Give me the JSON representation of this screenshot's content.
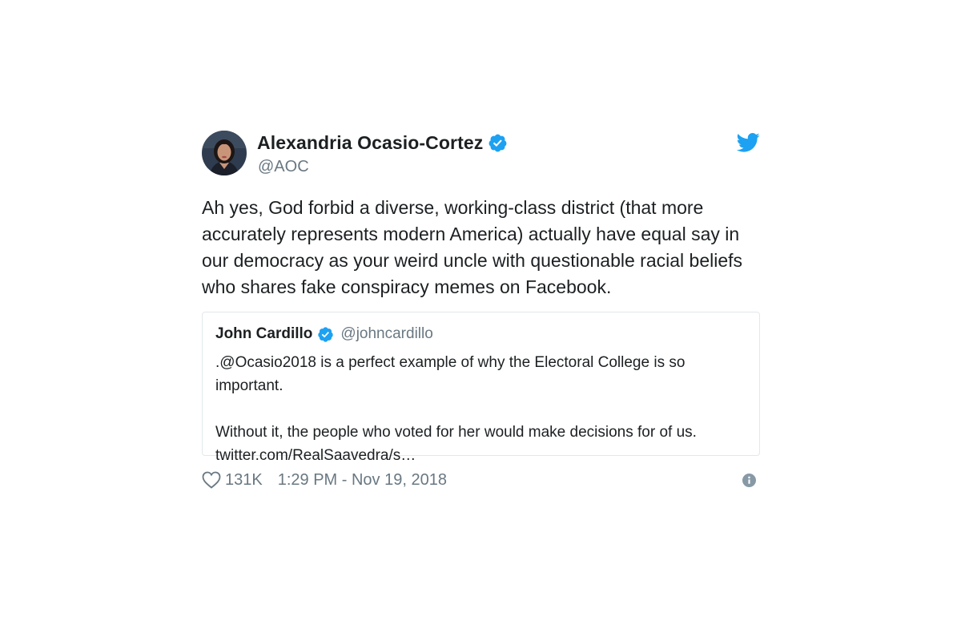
{
  "tweet": {
    "author": {
      "name": "Alexandria Ocasio-Cortez",
      "handle": "@AOC",
      "verified_icon": "verified-badge-icon"
    },
    "text": "Ah yes, God forbid a diverse, working-class district (that more accurately represents modern America) actually have equal say in our democracy as your weird uncle with questionable racial beliefs who shares fake conspiracy memes on Facebook.",
    "quoted": {
      "name": "John Cardillo",
      "handle": "@johncardillo",
      "paragraphs": [
        ".@Ocasio2018 is a perfect example of why the Electoral College is so important.",
        "Without it, the people who voted for her would make decisions for of us. twitter.com/RealSaavedra/s…"
      ]
    },
    "footer": {
      "likes": "131K",
      "timestamp": "1:29 PM - Nov 19, 2018"
    },
    "icons": {
      "brand": "twitter-bird-icon",
      "like": "heart-icon",
      "info": "info-icon"
    }
  },
  "colors": {
    "twitter_blue": "#1da1f2",
    "text": "#1c2022",
    "secondary_text": "#697882",
    "border": "#e1e8ed"
  }
}
